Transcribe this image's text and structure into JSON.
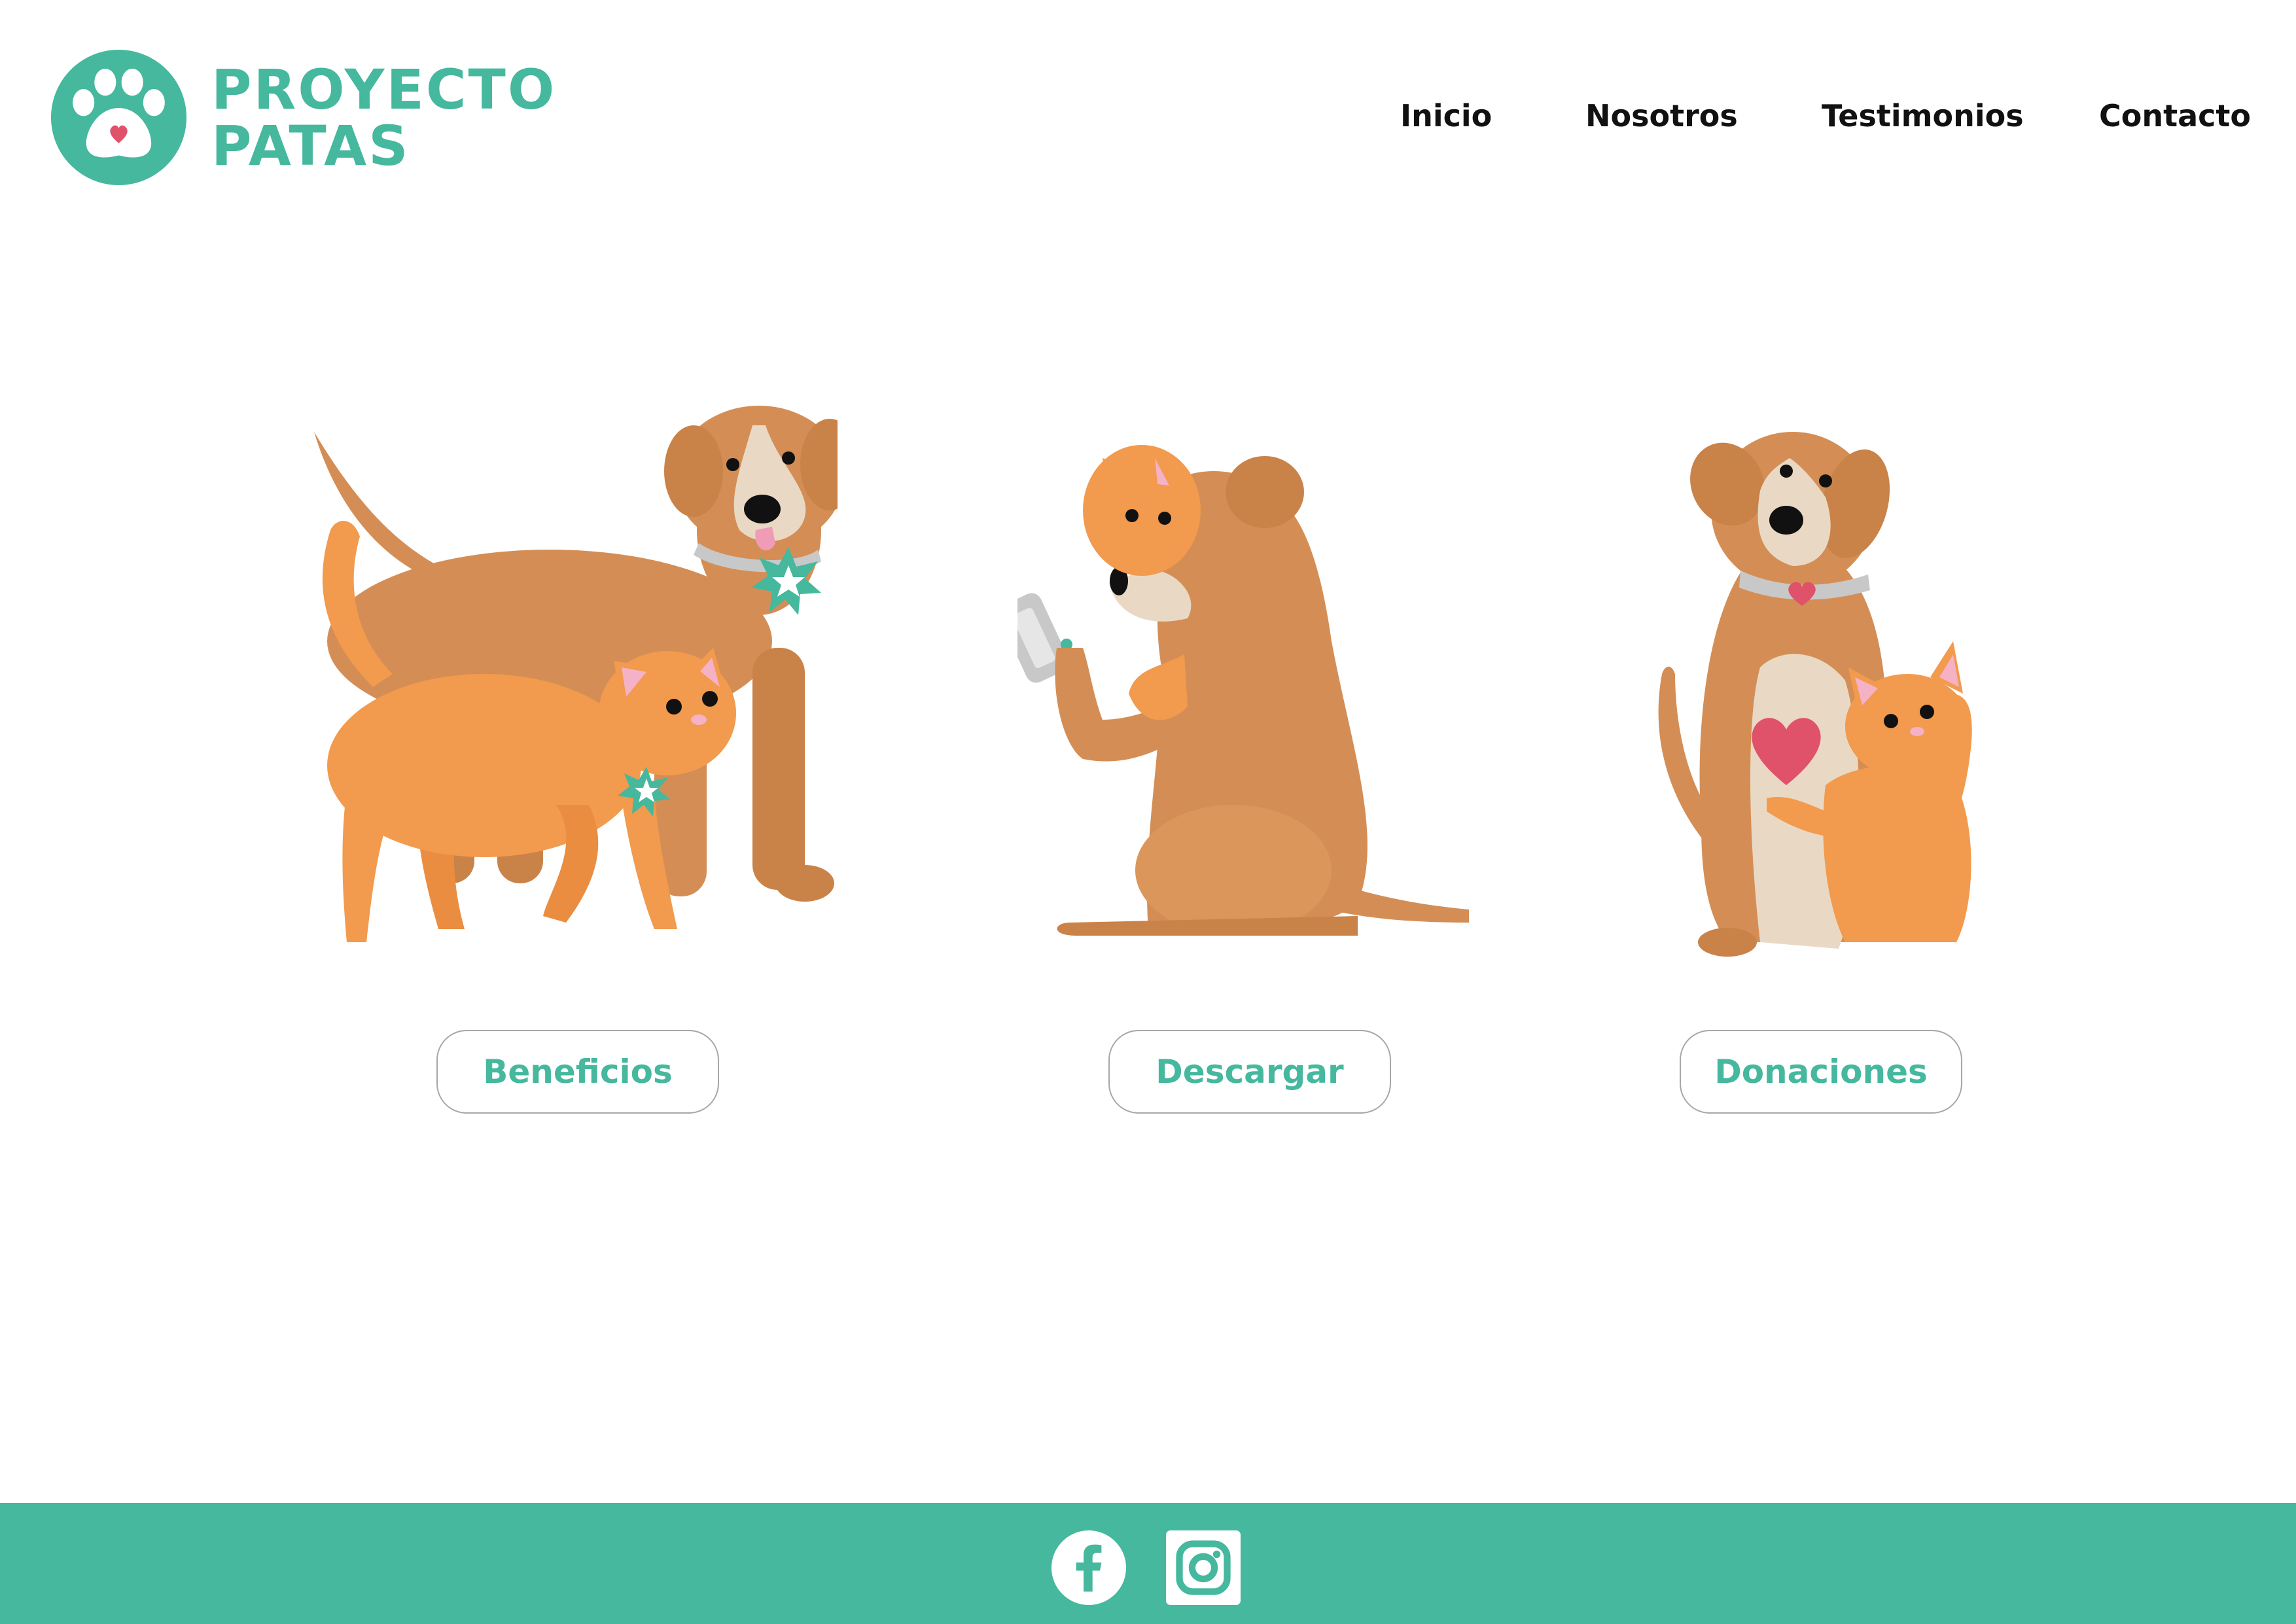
{
  "brand": {
    "line1": "PROYECTO",
    "line2": "PATAS",
    "color": "#45b89e",
    "accent": "#e0516a"
  },
  "nav": {
    "items": [
      "Inicio",
      "Nosotros",
      "Testimonios",
      "Contacto"
    ]
  },
  "actions": {
    "buttons": [
      "Beneficios",
      "Descargar",
      "Donaciones"
    ]
  },
  "footer": {
    "color": "#45b89e",
    "icons": [
      "facebook-icon",
      "instagram-icon"
    ]
  },
  "palette": {
    "dog": "#d48e55",
    "cat": "#f29a4d",
    "cream": "#e9d9c4",
    "collar": "#c8c8c8"
  }
}
